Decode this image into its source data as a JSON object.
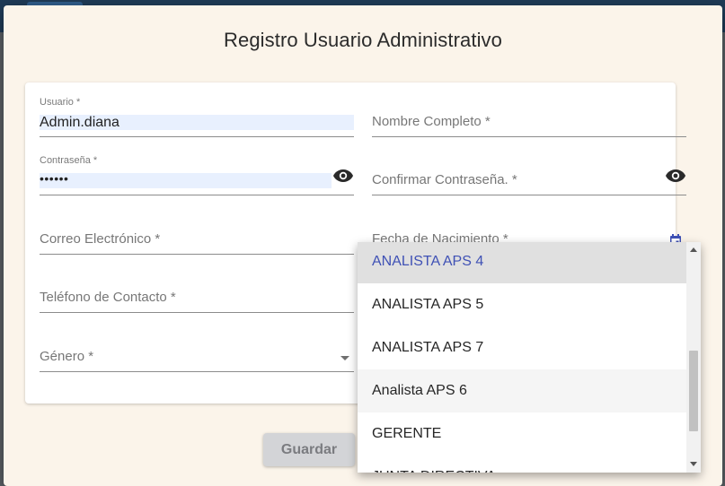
{
  "colors": {
    "dialog_background": "#fbf4ea",
    "autofill_background": "#e8f0fe",
    "selected_option_text": "#3f51b5",
    "selected_option_background": "#e0e0e0",
    "hover_option_background": "#f5f5f5",
    "calendar_icon": "#3f51b5"
  },
  "dialog": {
    "title": "Registro Usuario Administrativo"
  },
  "form": {
    "usuario": {
      "label": "Usuario *",
      "value": "Admin.diana"
    },
    "nombre_completo": {
      "placeholder": "Nombre Completo *"
    },
    "contrasena": {
      "label": "Contraseña *",
      "value": "••••••",
      "toggle_icon": "eye-icon"
    },
    "confirmar_contrasena": {
      "placeholder": "Confirmar Contraseña. *",
      "toggle_icon": "eye-icon"
    },
    "correo": {
      "placeholder": "Correo Electrónico *"
    },
    "fecha_nacimiento": {
      "placeholder": "Fecha de Nacimiento *",
      "icon": "calendar-icon"
    },
    "telefono": {
      "placeholder": "Teléfono de Contacto *"
    },
    "genero": {
      "placeholder": "Género *",
      "icon": "dropdown-arrow-icon"
    }
  },
  "actions": {
    "guardar_label": "Guardar"
  },
  "dropdown": {
    "options": [
      {
        "label": "ANALISTA APS 4",
        "state": "selected"
      },
      {
        "label": "ANALISTA APS 5",
        "state": "normal"
      },
      {
        "label": "ANALISTA APS 7",
        "state": "normal"
      },
      {
        "label": "Analista APS 6",
        "state": "hover"
      },
      {
        "label": "GERENTE",
        "state": "normal"
      },
      {
        "label": "JUNTA DIRECTIVA",
        "state": "normal"
      }
    ]
  }
}
